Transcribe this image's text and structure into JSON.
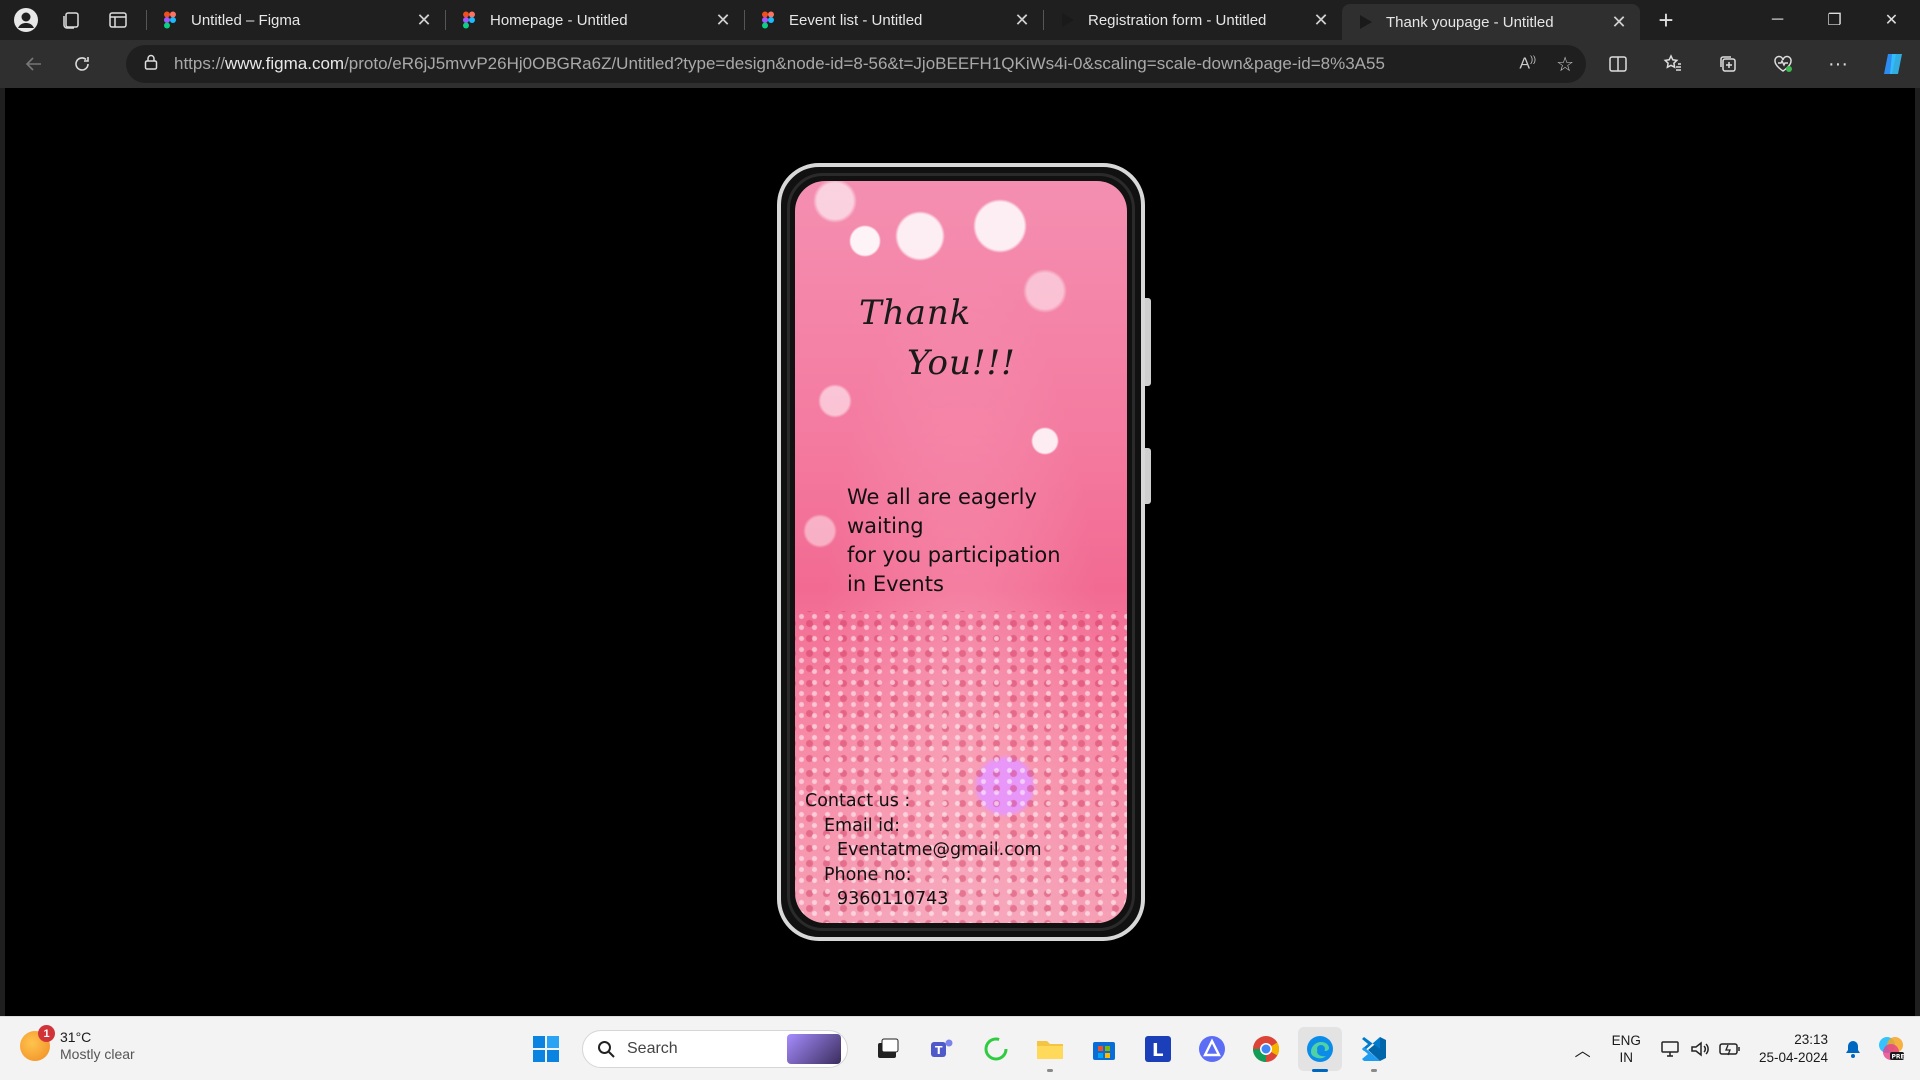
{
  "browser": {
    "tabs": [
      {
        "title": "Untitled – Figma",
        "favicon": "figma-icon"
      },
      {
        "title": "Homepage - Untitled",
        "favicon": "figma-icon"
      },
      {
        "title": "Eevent list - Untitled",
        "favicon": "figma-icon"
      },
      {
        "title": "Registration form - Untitled",
        "favicon": "play-icon"
      },
      {
        "title": "Thank youpage - Untitled",
        "favicon": "play-icon",
        "active": true
      }
    ],
    "url_prefix": "https://",
    "url_host": "www.figma.com",
    "url_path": "/proto/eR6jJ5mvvP26Hj0OBGRa6Z/Untitled?type=design&node-id=8-56&t=JjoBEEFH1QKiWs4i-0&scaling=scale-down&page-id=8%3A55"
  },
  "prototype": {
    "heading_line1": "Thank",
    "heading_line2": "You!!!",
    "message": [
      "We all are eagerly",
      "waiting",
      "for you participation",
      "in Events"
    ],
    "contact_label": "Contact us :",
    "email_label": "Email id:",
    "email": "Eventatme@gmail.com",
    "phone_label": "Phone no:",
    "phone": "9360110743"
  },
  "taskbar": {
    "weather_badge": "1",
    "temperature": "31°C",
    "condition": "Mostly clear",
    "search_placeholder": "Search",
    "lang_line1": "ENG",
    "lang_line2": "IN",
    "time": "23:13",
    "date": "25-04-2024"
  },
  "colors": {
    "accent": "#0067c0",
    "browser_dark": "#1f1f1f",
    "pink_bg": "#f47aa0"
  }
}
